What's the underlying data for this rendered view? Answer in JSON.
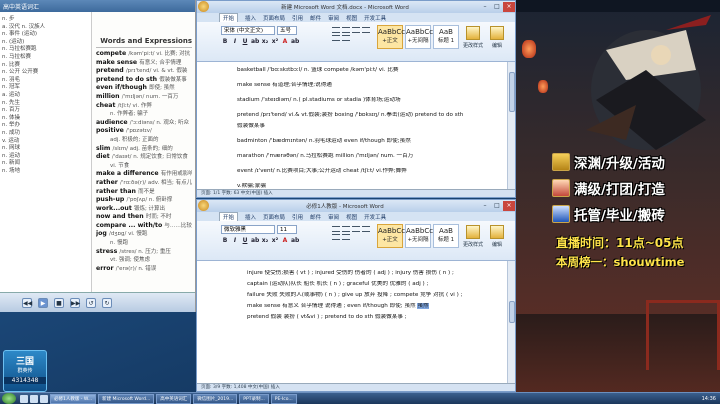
{
  "dictionary": {
    "title": "高中英语词汇",
    "header": "Words and Expressions",
    "left_lines": [
      "n. 步",
      "a. 汉代 n. 汉族人",
      "n. 事件 (运动)",
      "n. (运动)",
      "n. 马拉松赛跑",
      "n. 马拉松赛",
      "n. 比赛",
      "n. 公开 公开赛",
      "n. 羽毛",
      "n. 冠军",
      "a. 运动",
      "n. 先生",
      "n. 百万",
      "n. 体操",
      "n. 举办",
      "n. 成功",
      "v. 运动",
      "n. 网球",
      "n. 运动",
      "n. 新闻",
      "n. 场地"
    ],
    "entries": [
      {
        "word": "compete",
        "def": "/kəm'piːt/ vi. 比赛; 对抗"
      },
      {
        "word": "make sense",
        "def": "有意义; 合乎情理"
      },
      {
        "word": "pretend",
        "def": "/prɪ'tend/ vi. & vt. 假装"
      },
      {
        "word": "pretend to do sth",
        "def": "假装做某事"
      },
      {
        "word": "even if/though",
        "def": "即使; 虽然"
      },
      {
        "word": "million",
        "def": "/'mɪljən/ num. 一百万"
      },
      {
        "word": "cheat",
        "def": "/tʃiːt/ vi. 作弊"
      },
      {
        "word": "",
        "def": "n. 作弊者; 骗子"
      },
      {
        "word": "audience",
        "def": "/'ɔːdiəns/ n. 观众; 听众"
      },
      {
        "word": "positive",
        "def": "/'pɒzətɪv/"
      },
      {
        "word": "",
        "def": "adj. 积极的; 正面的"
      },
      {
        "word": "slim",
        "def": "/slɪm/ adj. 苗条的; 细的"
      },
      {
        "word": "diet",
        "def": "/'daɪət/ n. 规定饮食; 日常饮食"
      },
      {
        "word": "",
        "def": "vi. 节食"
      },
      {
        "word": "make a difference",
        "def": "有作用或影响"
      },
      {
        "word": "rather",
        "def": "/'rɑːðə(r)/ adv. 相当; 有点儿"
      },
      {
        "word": "rather than",
        "def": "而不是"
      },
      {
        "word": "push-up",
        "def": "/'pʊʃʌp/ n. 俯卧撑"
      },
      {
        "word": "work...out",
        "def": "锻炼; 计算出"
      },
      {
        "word": "now and then",
        "def": "时而; 不时"
      },
      {
        "word": "compare ... with/to",
        "def": "与……比较"
      },
      {
        "word": "jog",
        "def": "/dʒɒg/ vi. 慢跑"
      },
      {
        "word": "",
        "def": "n. 慢跑"
      },
      {
        "word": "stress",
        "def": "/stres/ n. 压力; 重压"
      },
      {
        "word": "",
        "def": "vt. 强调; 使焦虑"
      },
      {
        "word": "error",
        "def": "/'erə(r)/ n. 错误"
      }
    ]
  },
  "player": {
    "buttons": [
      "◀◀",
      "▶",
      "■",
      "▶▶",
      "↺",
      "↻"
    ]
  },
  "word1": {
    "title": "新建 Microsoft Word 文档.docx - Microsoft Word",
    "tabs": [
      "开始",
      "插入",
      "页面布局",
      "引用",
      "邮件",
      "审阅",
      "视图",
      "开发工具"
    ],
    "font": "宋体 (中文正文)",
    "size": "五号",
    "styles": [
      {
        "big": "AaBbCcD",
        "name": "+正文"
      },
      {
        "big": "AaBbCcD",
        "name": "+无间隔"
      },
      {
        "big": "AaB",
        "name": "标题 1"
      }
    ],
    "change_styles": "更改样式",
    "edit": "编辑",
    "lines": [
      "basketball /'bɑːskɪtbɔːl/ n. 篮球   compete /kəm'piːt/ vi. 比赛",
      "make sense 有道理;合乎情理;说得通",
      "stadium /'steɪdiəm/ n.( pl.stadiums or stadia )体育场;运动场",
      "pretend /prɪ'tend/ vi.& vt.假装;装扮 boxing /'bɒksɪŋ/ n.拳击(运动)  pretend to do sth",
      "假装做某事",
      "badminton /'bædmɪntən/ n.羽毛球运动  even if/though 即使;虽然",
      "marathon /'mærəθən/ n.马拉松赛跑  million /'mɪljən/ num. 一百万",
      "event /ɪ'vent/ n.比赛项目;大事;公开运动  cheat /tʃiːt/ vi.作弊;舞弊",
      "v.欺骗;蒙骗"
    ],
    "status": "页面: 1/1   字数: 63   中文(中国)   插入"
  },
  "word2": {
    "title": "必修1人教版 - Microsoft Word",
    "tabs": [
      "开始",
      "插入",
      "页面布局",
      "引用",
      "邮件",
      "审阅",
      "视图",
      "开发工具"
    ],
    "font": "微软雅黑",
    "size": "11",
    "styles": [
      {
        "big": "AaBbCcD",
        "name": "+正文"
      },
      {
        "big": "AaBbCcD",
        "name": "+无间隔"
      },
      {
        "big": "AaB",
        "name": "标题 1"
      }
    ],
    "change_styles": "更改样式",
    "edit": "编辑",
    "lines": [
      "injure 使受伤;损害 ( vt ) ; injured 受伤的 伤者的 ( adj ) ; injury 伤害 损伤 ( n ) ;",
      "captain (运动队)队长 船长 机长 ( n ) ; graceful 优美的 优雅的 ( adj ) ;",
      "failure 失败 失败的人(或事物) ( n ) ; give up 放弃 投降 ; compete 竞争 对抗 ( vi ) ;",
      "make sense 有意义 合乎情理 说得通 ; even if/though 即使; 虽然 ",
      "pretend 假装 装扮 ( vt&vi ) ; pretend to do sth 假装做某事 ;"
    ],
    "highlight": "虽然",
    "status": "页面: 3/9   字数: 1,408   中文(中国)   插入"
  },
  "stream": {
    "promos": [
      "深渊/升级/活动",
      "满级/打团/打造",
      "托管/毕业/搬砖"
    ],
    "live_time": "直播时间：11点~05点",
    "weekly": "本周榜一：shouwtime"
  },
  "badge": {
    "title": "三国",
    "subtitle": "群英传",
    "number": "4314348"
  },
  "taskbar": {
    "items": [
      "必修1人教版 - W...",
      "新建 Microsoft Word...",
      "高中英语词汇",
      "微信图片_2019...",
      "PPT录制...",
      "PE-Ico..."
    ],
    "tray": "14:36"
  }
}
